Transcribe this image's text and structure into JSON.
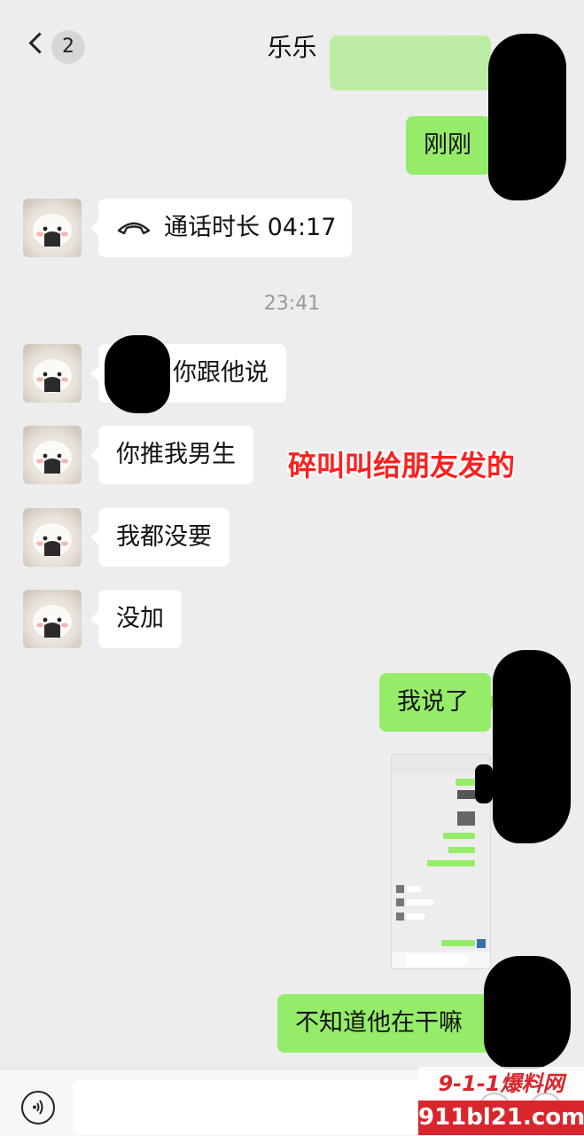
{
  "header": {
    "unread_count": "2",
    "title": "乐乐"
  },
  "messages": [
    {
      "direction": "out",
      "text": "刚刚"
    },
    {
      "direction": "in",
      "type": "call",
      "text": "通话时长 04:17"
    },
    {
      "type": "time",
      "text": "23:41"
    },
    {
      "direction": "in",
      "text": "你跟他说"
    },
    {
      "direction": "in",
      "text": "你推我男生"
    },
    {
      "direction": "in",
      "text": "我都没要"
    },
    {
      "direction": "in",
      "text": "没加"
    },
    {
      "direction": "out",
      "text": "我说了"
    },
    {
      "direction": "out",
      "type": "image",
      "text": ""
    },
    {
      "direction": "out",
      "text": "不知道他在干嘛"
    }
  ],
  "annotation": "碎叫叫给朋友发的",
  "watermark": {
    "line1": "9-1-1爆料网",
    "line2": "911bl21.com"
  },
  "colors": {
    "background": "#ededed",
    "outgoing_bubble": "#95ec69",
    "incoming_bubble": "#ffffff",
    "annotation": "#ff1f1f",
    "watermark": "#d8262c"
  },
  "icons": {
    "back": "chevron-left-icon",
    "call": "phone-hangup-icon",
    "voice": "voice-icon",
    "emoji": "emoji-icon",
    "more": "plus-icon"
  }
}
